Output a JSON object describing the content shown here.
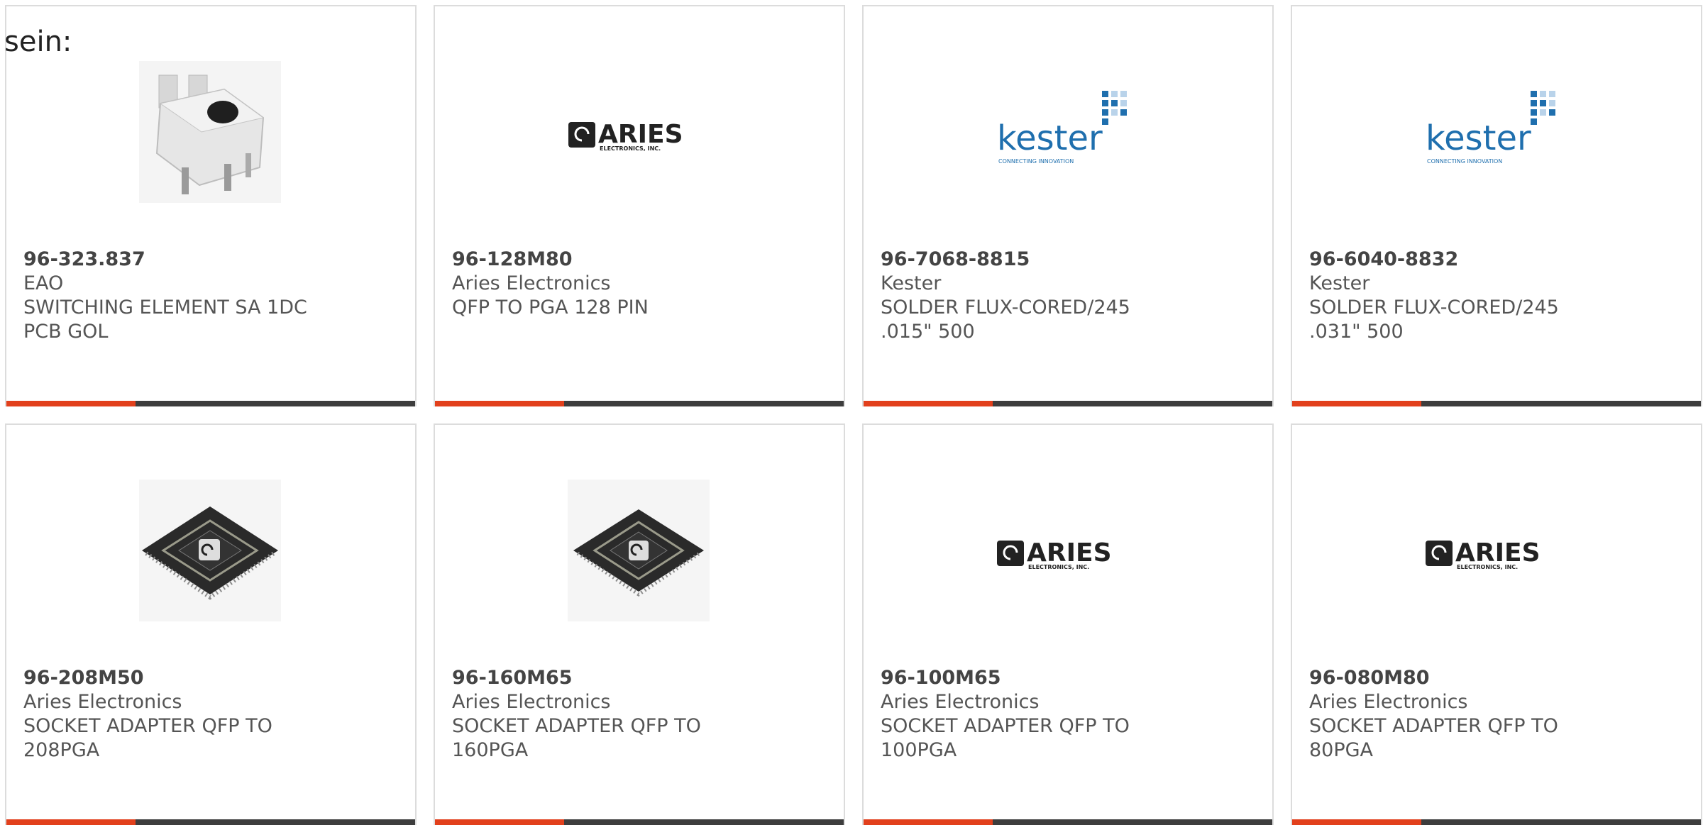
{
  "intro_text": "sein:",
  "products": [
    {
      "part_number": "96-323.837",
      "manufacturer": "EAO",
      "description": "SWITCHING ELEMENT SA 1DC PCB GOL",
      "image": "switch-photo"
    },
    {
      "part_number": "96-128M80",
      "manufacturer": "Aries Electronics",
      "description": "QFP TO PGA 128 PIN",
      "image": "aries-logo"
    },
    {
      "part_number": "96-7068-8815",
      "manufacturer": "Kester",
      "description": "SOLDER FLUX-CORED/245 .015\" 500",
      "image": "kester-logo"
    },
    {
      "part_number": "96-6040-8832",
      "manufacturer": "Kester",
      "description": "SOLDER FLUX-CORED/245 .031\" 500",
      "image": "kester-logo"
    },
    {
      "part_number": "96-208M50",
      "manufacturer": "Aries Electronics",
      "description": "SOCKET ADAPTER QFP TO 208PGA",
      "image": "chip-photo"
    },
    {
      "part_number": "96-160M65",
      "manufacturer": "Aries Electronics",
      "description": "SOCKET ADAPTER QFP TO 160PGA",
      "image": "chip-photo"
    },
    {
      "part_number": "96-100M65",
      "manufacturer": "Aries Electronics",
      "description": "SOCKET ADAPTER QFP TO 100PGA",
      "image": "aries-logo"
    },
    {
      "part_number": "96-080M80",
      "manufacturer": "Aries Electronics",
      "description": "SOCKET ADAPTER QFP TO 80PGA",
      "image": "aries-logo"
    }
  ],
  "logos": {
    "aries": {
      "name": "ARIES",
      "sub": "ELECTRONICS, INC."
    },
    "kester": {
      "name": "kester",
      "tagline": "CONNECTING INNOVATION"
    }
  },
  "colors": {
    "accent": "#e2401c",
    "bar": "#3d3d3d",
    "kester_blue": "#1f6fae"
  }
}
